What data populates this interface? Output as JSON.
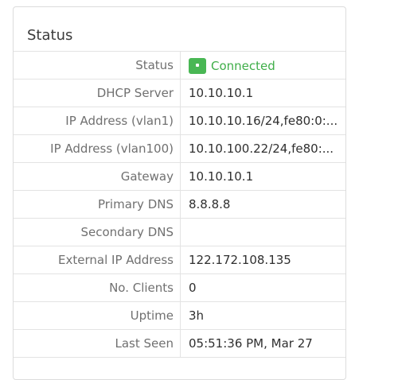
{
  "panel": {
    "title": "Status"
  },
  "rows": [
    {
      "label": "Status",
      "value": "Connected",
      "status": true
    },
    {
      "label": "DHCP Server",
      "value": "10.10.10.1"
    },
    {
      "label": "IP Address (vlan1)",
      "value": "10.10.10.16/24,fe80:0:..."
    },
    {
      "label": "IP Address (vlan100)",
      "value": "10.10.100.22/24,fe80:..."
    },
    {
      "label": "Gateway",
      "value": "10.10.10.1"
    },
    {
      "label": "Primary DNS",
      "value": "8.8.8.8"
    },
    {
      "label": "Secondary DNS",
      "value": ""
    },
    {
      "label": "External IP Address",
      "value": "122.172.108.135"
    },
    {
      "label": "No. Clients",
      "value": "0"
    },
    {
      "label": "Uptime",
      "value": "3h"
    },
    {
      "label": "Last Seen",
      "value": "05:51:36 PM, Mar 27"
    }
  ],
  "colors": {
    "status_ok": "#49b754"
  },
  "icons": {
    "status": "connected-status-icon"
  }
}
